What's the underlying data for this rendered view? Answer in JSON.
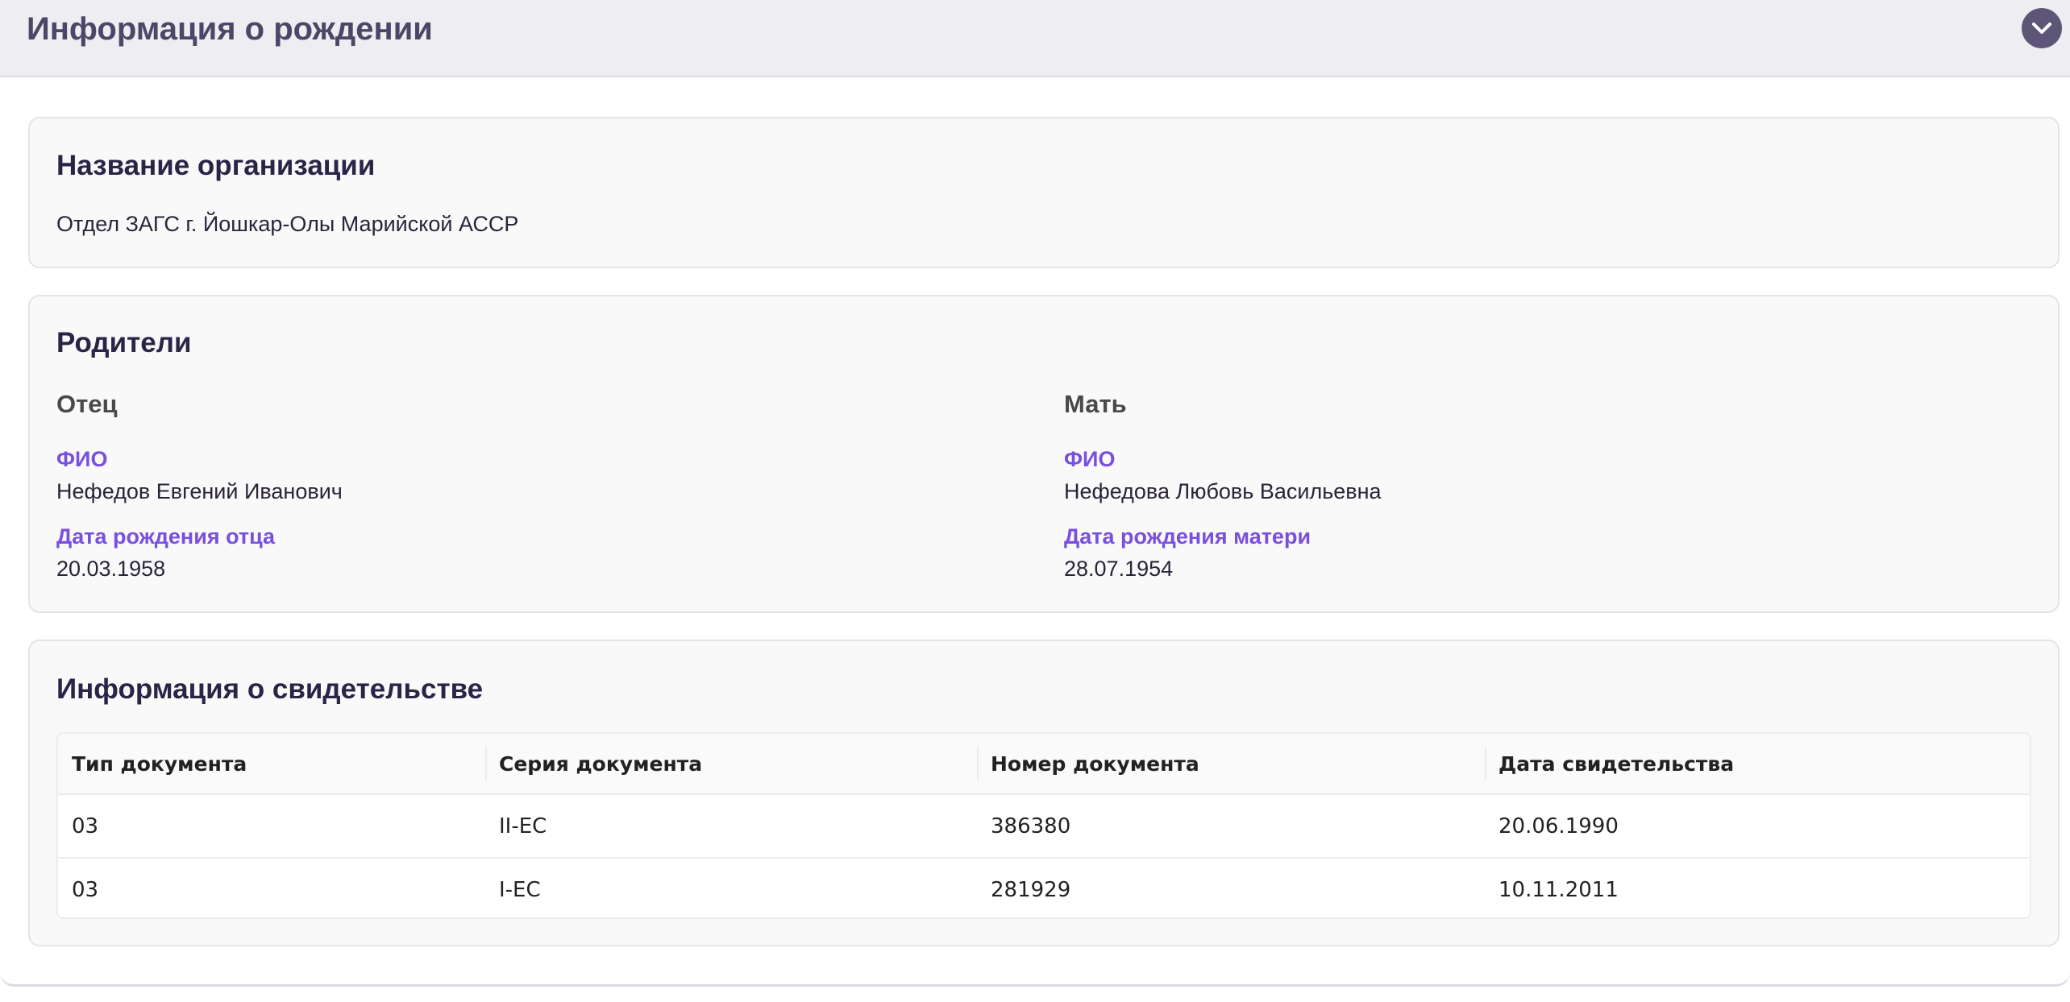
{
  "accordion": {
    "title": "Информация о рождении",
    "toggle_icon": "chevron-down-icon"
  },
  "organization": {
    "title": "Название организации",
    "value": "Отдел ЗАГС г. Йошкар-Олы Марийской АССР"
  },
  "parents": {
    "title": "Родители",
    "father": {
      "heading": "Отец",
      "name_label": "ФИО",
      "name": "Нефедов Евгений Иванович",
      "birth_label": "Дата рождения отца",
      "birth_date": "20.03.1958"
    },
    "mother": {
      "heading": "Мать",
      "name_label": "ФИО",
      "name": "Нефедова Любовь Васильевна",
      "birth_label": "Дата рождения матери",
      "birth_date": "28.07.1954"
    }
  },
  "certificate": {
    "title": "Информация о свидетельстве",
    "columns": [
      "Тип документа",
      "Серия документа",
      "Номер документа",
      "Дата свидетельства"
    ],
    "rows": [
      [
        "03",
        "II-ЕС",
        "386380",
        "20.06.1990"
      ],
      [
        "03",
        "I-ЕС",
        "281929",
        "10.11.2011"
      ]
    ]
  },
  "colors": {
    "header_bg": "#eeedf2",
    "accent_label": "#7a4fdf",
    "toggle_bg": "#5e5678"
  }
}
